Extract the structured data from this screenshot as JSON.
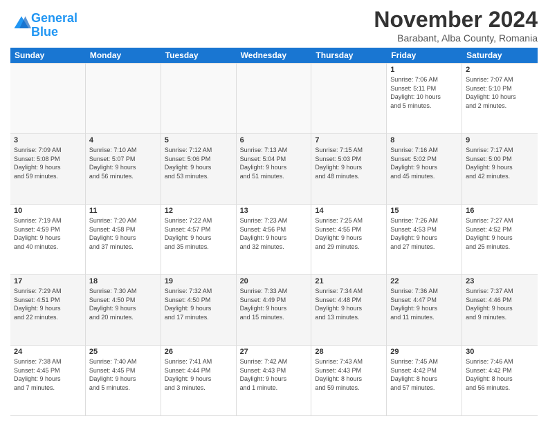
{
  "logo": {
    "line1": "General",
    "line2": "Blue"
  },
  "title": "November 2024",
  "subtitle": "Barabant, Alba County, Romania",
  "header_days": [
    "Sunday",
    "Monday",
    "Tuesday",
    "Wednesday",
    "Thursday",
    "Friday",
    "Saturday"
  ],
  "weeks": [
    [
      {
        "day": "",
        "info": ""
      },
      {
        "day": "",
        "info": ""
      },
      {
        "day": "",
        "info": ""
      },
      {
        "day": "",
        "info": ""
      },
      {
        "day": "",
        "info": ""
      },
      {
        "day": "1",
        "info": "Sunrise: 7:06 AM\nSunset: 5:11 PM\nDaylight: 10 hours\nand 5 minutes."
      },
      {
        "day": "2",
        "info": "Sunrise: 7:07 AM\nSunset: 5:10 PM\nDaylight: 10 hours\nand 2 minutes."
      }
    ],
    [
      {
        "day": "3",
        "info": "Sunrise: 7:09 AM\nSunset: 5:08 PM\nDaylight: 9 hours\nand 59 minutes."
      },
      {
        "day": "4",
        "info": "Sunrise: 7:10 AM\nSunset: 5:07 PM\nDaylight: 9 hours\nand 56 minutes."
      },
      {
        "day": "5",
        "info": "Sunrise: 7:12 AM\nSunset: 5:06 PM\nDaylight: 9 hours\nand 53 minutes."
      },
      {
        "day": "6",
        "info": "Sunrise: 7:13 AM\nSunset: 5:04 PM\nDaylight: 9 hours\nand 51 minutes."
      },
      {
        "day": "7",
        "info": "Sunrise: 7:15 AM\nSunset: 5:03 PM\nDaylight: 9 hours\nand 48 minutes."
      },
      {
        "day": "8",
        "info": "Sunrise: 7:16 AM\nSunset: 5:02 PM\nDaylight: 9 hours\nand 45 minutes."
      },
      {
        "day": "9",
        "info": "Sunrise: 7:17 AM\nSunset: 5:00 PM\nDaylight: 9 hours\nand 42 minutes."
      }
    ],
    [
      {
        "day": "10",
        "info": "Sunrise: 7:19 AM\nSunset: 4:59 PM\nDaylight: 9 hours\nand 40 minutes."
      },
      {
        "day": "11",
        "info": "Sunrise: 7:20 AM\nSunset: 4:58 PM\nDaylight: 9 hours\nand 37 minutes."
      },
      {
        "day": "12",
        "info": "Sunrise: 7:22 AM\nSunset: 4:57 PM\nDaylight: 9 hours\nand 35 minutes."
      },
      {
        "day": "13",
        "info": "Sunrise: 7:23 AM\nSunset: 4:56 PM\nDaylight: 9 hours\nand 32 minutes."
      },
      {
        "day": "14",
        "info": "Sunrise: 7:25 AM\nSunset: 4:55 PM\nDaylight: 9 hours\nand 29 minutes."
      },
      {
        "day": "15",
        "info": "Sunrise: 7:26 AM\nSunset: 4:53 PM\nDaylight: 9 hours\nand 27 minutes."
      },
      {
        "day": "16",
        "info": "Sunrise: 7:27 AM\nSunset: 4:52 PM\nDaylight: 9 hours\nand 25 minutes."
      }
    ],
    [
      {
        "day": "17",
        "info": "Sunrise: 7:29 AM\nSunset: 4:51 PM\nDaylight: 9 hours\nand 22 minutes."
      },
      {
        "day": "18",
        "info": "Sunrise: 7:30 AM\nSunset: 4:50 PM\nDaylight: 9 hours\nand 20 minutes."
      },
      {
        "day": "19",
        "info": "Sunrise: 7:32 AM\nSunset: 4:50 PM\nDaylight: 9 hours\nand 17 minutes."
      },
      {
        "day": "20",
        "info": "Sunrise: 7:33 AM\nSunset: 4:49 PM\nDaylight: 9 hours\nand 15 minutes."
      },
      {
        "day": "21",
        "info": "Sunrise: 7:34 AM\nSunset: 4:48 PM\nDaylight: 9 hours\nand 13 minutes."
      },
      {
        "day": "22",
        "info": "Sunrise: 7:36 AM\nSunset: 4:47 PM\nDaylight: 9 hours\nand 11 minutes."
      },
      {
        "day": "23",
        "info": "Sunrise: 7:37 AM\nSunset: 4:46 PM\nDaylight: 9 hours\nand 9 minutes."
      }
    ],
    [
      {
        "day": "24",
        "info": "Sunrise: 7:38 AM\nSunset: 4:45 PM\nDaylight: 9 hours\nand 7 minutes."
      },
      {
        "day": "25",
        "info": "Sunrise: 7:40 AM\nSunset: 4:45 PM\nDaylight: 9 hours\nand 5 minutes."
      },
      {
        "day": "26",
        "info": "Sunrise: 7:41 AM\nSunset: 4:44 PM\nDaylight: 9 hours\nand 3 minutes."
      },
      {
        "day": "27",
        "info": "Sunrise: 7:42 AM\nSunset: 4:43 PM\nDaylight: 9 hours\nand 1 minute."
      },
      {
        "day": "28",
        "info": "Sunrise: 7:43 AM\nSunset: 4:43 PM\nDaylight: 8 hours\nand 59 minutes."
      },
      {
        "day": "29",
        "info": "Sunrise: 7:45 AM\nSunset: 4:42 PM\nDaylight: 8 hours\nand 57 minutes."
      },
      {
        "day": "30",
        "info": "Sunrise: 7:46 AM\nSunset: 4:42 PM\nDaylight: 8 hours\nand 56 minutes."
      }
    ]
  ]
}
